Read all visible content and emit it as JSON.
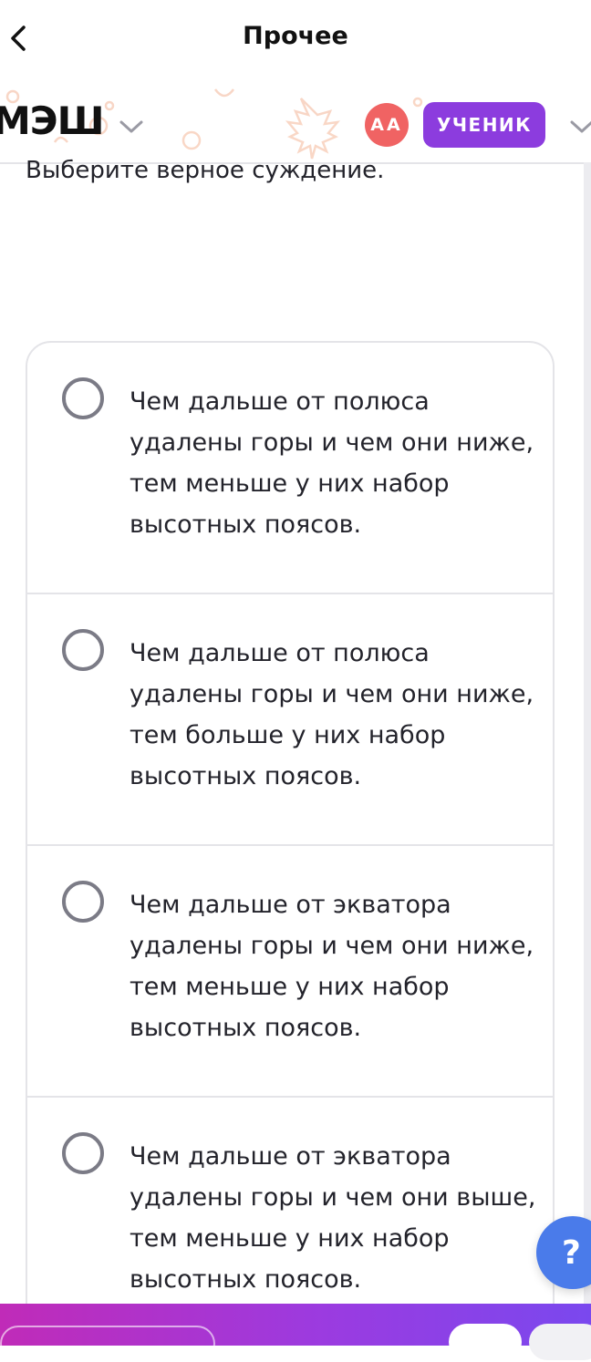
{
  "nav": {
    "title": "Прочее",
    "back_icon": "chevron-left-icon"
  },
  "header": {
    "logo": "МЭШ",
    "avatar_initials": "АА",
    "role": "УЧЕНИК",
    "colors": {
      "avatar": "#f06363",
      "role_badge": "#8c3cde"
    }
  },
  "question": {
    "prompt": "Выберите верное суждение."
  },
  "options": [
    {
      "text": "Чем дальше от полюса удалены горы и чем они ниже, тем меньше у них набор высотных поясов."
    },
    {
      "text": "Чем дальше от полюса удалены горы и чем они ниже, тем больше у них набор высотных поясов."
    },
    {
      "text": "Чем дальше от экватора удалены горы и чем они ниже, тем меньше у них набор высотных поясов."
    },
    {
      "text": "Чем дальше от экватора удалены горы и чем они выше, тем меньше у них набор высотных поясов."
    }
  ],
  "help": {
    "label": "?",
    "color": "#4a7bea"
  },
  "footer": {
    "gradient": [
      "#c02bb8",
      "#9b3be0",
      "#7a48ee"
    ]
  }
}
